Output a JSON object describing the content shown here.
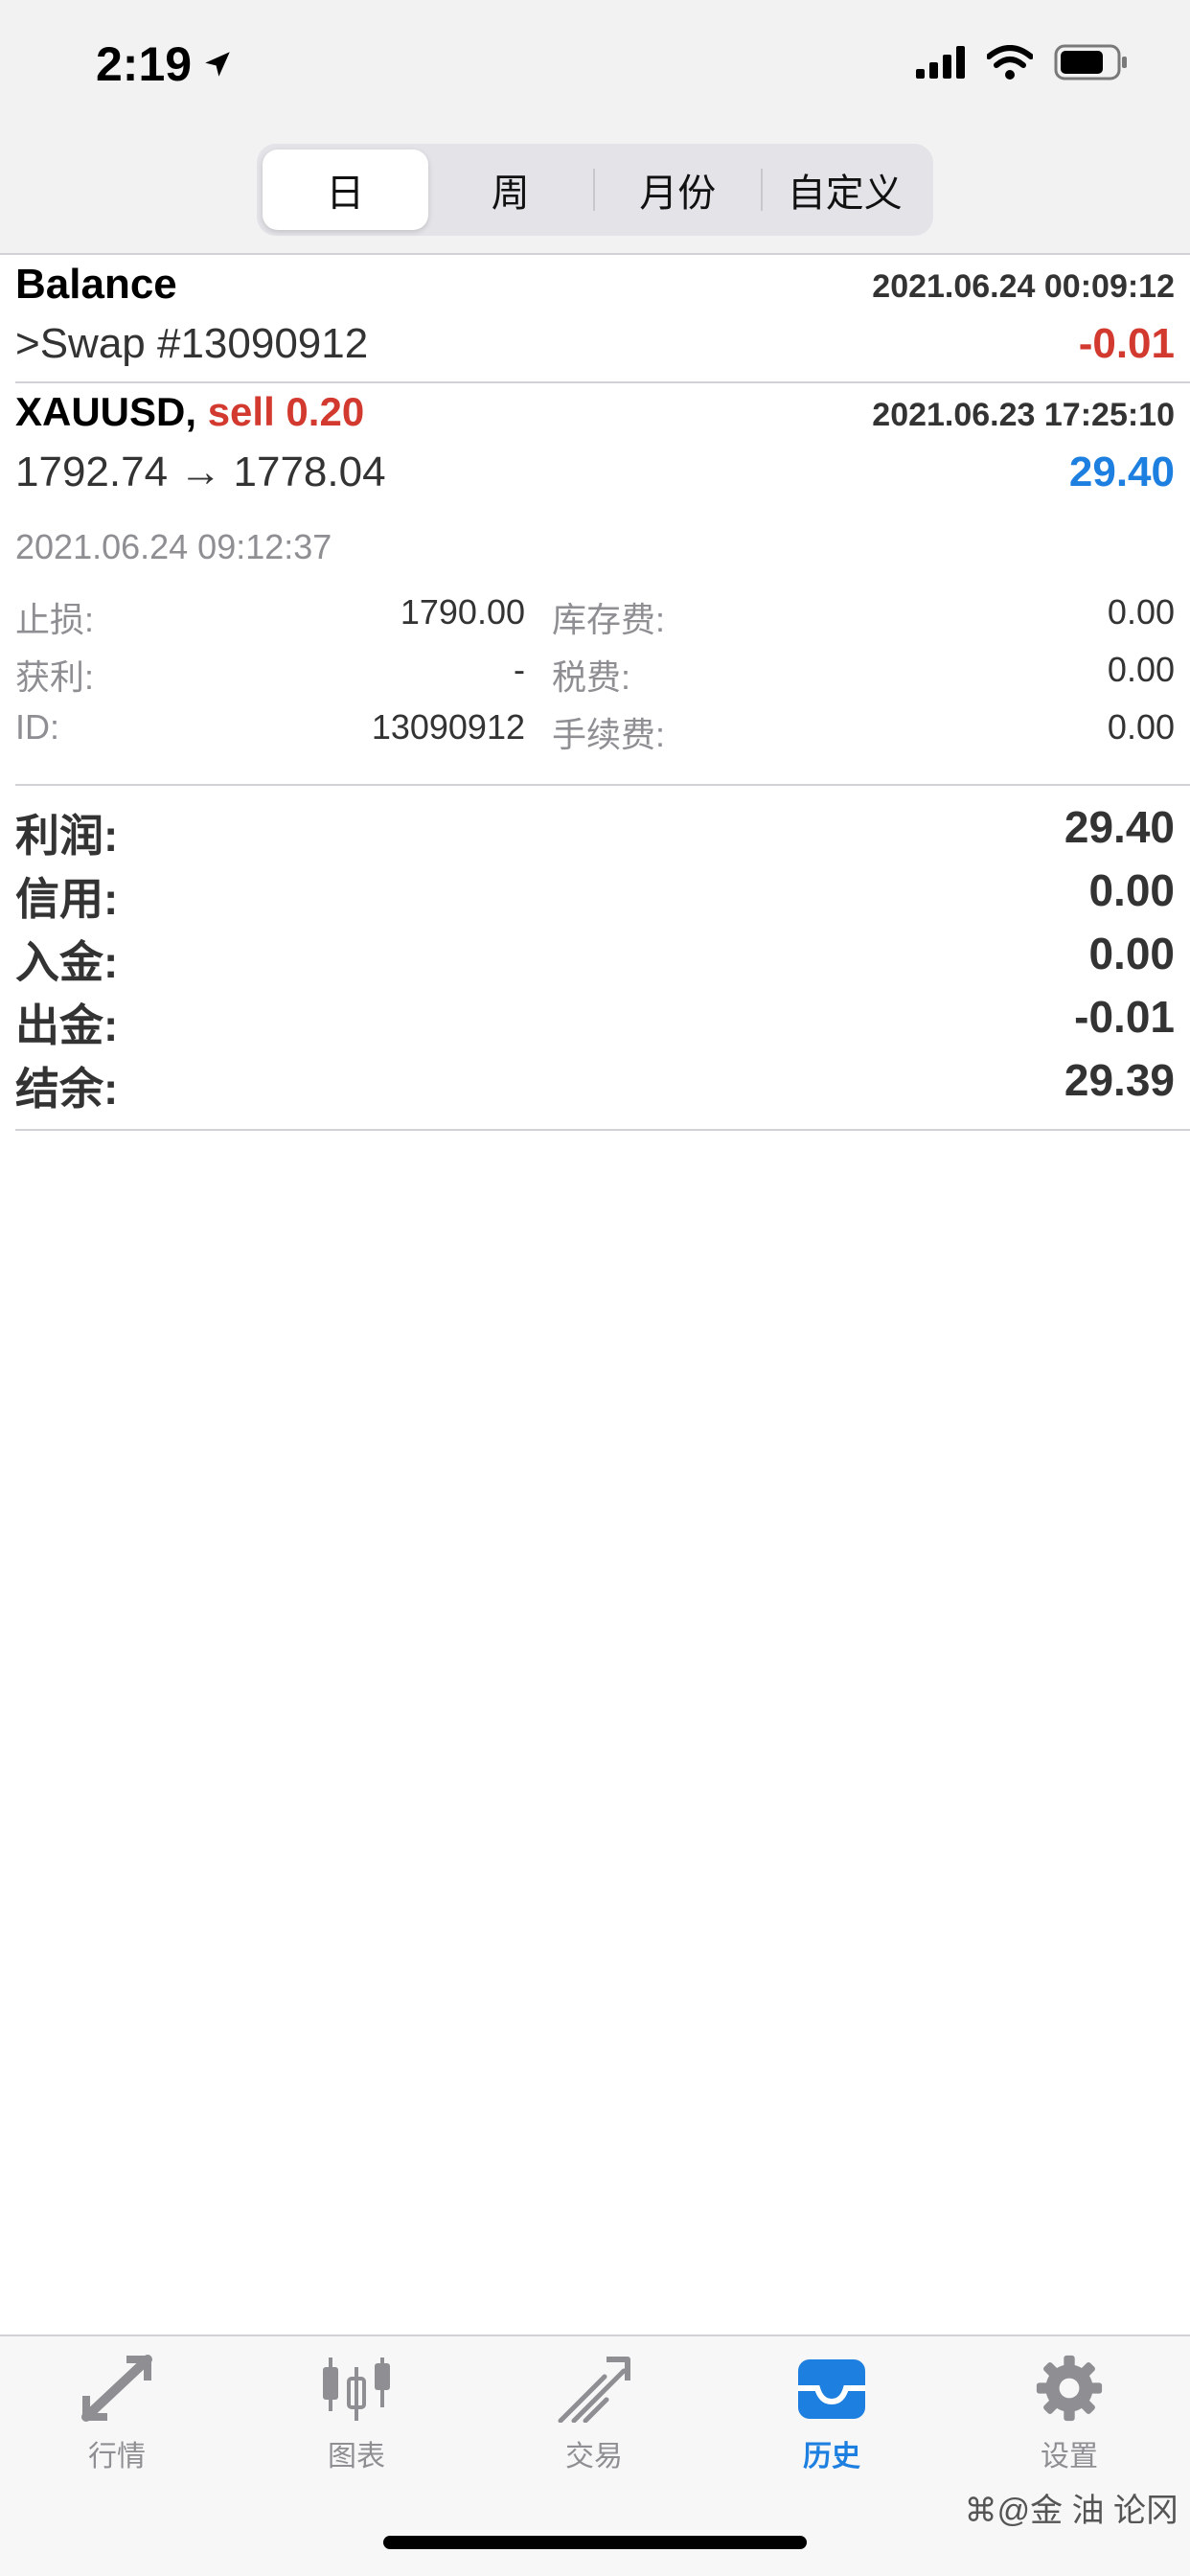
{
  "status_bar": {
    "time": "2:19"
  },
  "segments": [
    {
      "label": "日",
      "active": true
    },
    {
      "label": "周",
      "active": false
    },
    {
      "label": "月份",
      "active": false
    },
    {
      "label": "自定义",
      "active": false
    }
  ],
  "deal_balance": {
    "title": "Balance",
    "datetime": "2021.06.24 00:09:12",
    "comment": ">Swap #13090912",
    "amount": "-0.01"
  },
  "deal_trade": {
    "symbol": "XAUUSD,",
    "side": "sell 0.20",
    "datetime": "2021.06.23 17:25:10",
    "prices": "1792.74 → 1778.04",
    "profit": "29.40",
    "close_time": "2021.06.24 09:12:37",
    "details": {
      "sl_label": "止损:",
      "sl_value": "1790.00",
      "swap_label": "库存费:",
      "swap_value": "0.00",
      "tp_label": "获利:",
      "tp_value": "-",
      "tax_label": "税费:",
      "tax_value": "0.00",
      "id_label": "ID:",
      "id_value": "13090912",
      "fee_label": "手续费:",
      "fee_value": "0.00"
    }
  },
  "summary": [
    {
      "label": "利润:",
      "value": "29.40"
    },
    {
      "label": "信用:",
      "value": "0.00"
    },
    {
      "label": "入金:",
      "value": "0.00"
    },
    {
      "label": "出金:",
      "value": "-0.01"
    },
    {
      "label": "结余:",
      "value": "29.39"
    }
  ],
  "tabs": [
    {
      "label": "行情",
      "icon": "quotes-icon",
      "active": false
    },
    {
      "label": "图表",
      "icon": "chart-icon",
      "active": false
    },
    {
      "label": "交易",
      "icon": "trade-icon",
      "active": false
    },
    {
      "label": "历史",
      "icon": "history-icon",
      "active": true
    },
    {
      "label": "设置",
      "icon": "settings-icon",
      "active": false
    }
  ],
  "watermark": "@金 油 论冈",
  "colors": {
    "accent": "#1d7fe0",
    "negative": "#d33a2f"
  }
}
